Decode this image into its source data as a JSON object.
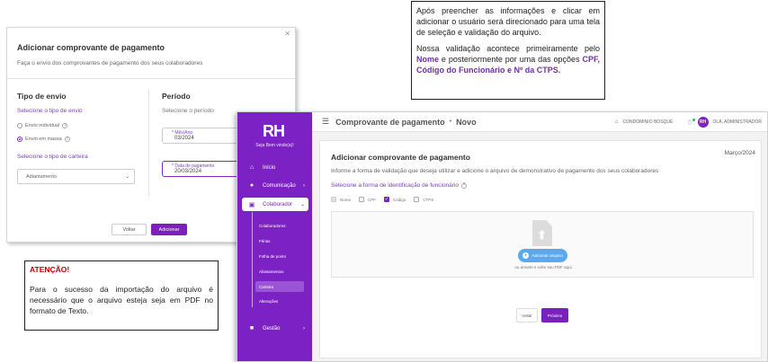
{
  "modal": {
    "close_icon": "close-icon",
    "title": "Adicionar comprovante de pagamento",
    "subtitle": "Faça o envio dos comprovantes de pagamento dos seus colaboradores",
    "left": {
      "heading": "Tipo de envio",
      "send_type_prompt": "Selecione o tipo de envio",
      "options": [
        {
          "label": "Envio individual",
          "selected": false
        },
        {
          "label": "Envio em massa",
          "selected": true
        }
      ],
      "wallet_prompt": "Selecione o tipo de carteira",
      "wallet_value": "Adiantamento"
    },
    "right": {
      "heading": "Período",
      "period_prompt": "Selecione o período",
      "month_label": "* Mês/Ano",
      "month_value": "03/2024",
      "date_label": "* Data de pagamento",
      "date_value": "20/03/2024"
    },
    "buttons": {
      "back": "Voltar",
      "add": "Adicionar"
    }
  },
  "note_top": {
    "p1": "Após preencher as informações e clicar em adicionar o usuário será direcionado para uma tela de seleção e validação do arquivo.",
    "p2_a": "Nossa validação acontece primeiramente pelo ",
    "p2_b": "Nome",
    "p2_c": " e posteriormente por uma das opções ",
    "p2_d": "CPF, Código do Funcionário e Nº da CTPS."
  },
  "note_bottom": {
    "warning": "ATENÇÃO!",
    "text": "Para o sucesso da importação do arquivo é necessário que o arquivo esteja seja em PDF no formato de Texto."
  },
  "app": {
    "logo": "RH",
    "welcome": "Seja Bem vindo(a)!",
    "nav": [
      {
        "label": "Início",
        "icon": "home-icon"
      },
      {
        "label": "Comunicação",
        "icon": "chat-icon"
      },
      {
        "label": "Colaborador",
        "icon": "id-card-icon"
      },
      {
        "label": "Gestão",
        "icon": "briefcase-icon"
      }
    ],
    "submenu": [
      "Colaboradores",
      "Férias",
      "Folha de ponto",
      "Afastamentos",
      "Carteira",
      "Alterações"
    ],
    "topbar": {
      "title": "Comprovante de pagamento",
      "separator": "•",
      "subtitle": "Novo",
      "company": "CONDOMINIO BOSQUE",
      "avatar": "RH",
      "user": "OLÁ, ADMINISTRADOR"
    },
    "card": {
      "title": "Adicionar comprovante de pagamento",
      "date": "Março/2024",
      "subtitle": "Informe a forma de validação que deseja utilizar e adicione o arquivo de demonstrativo de pagamento dos seus colaboradores",
      "select_prompt": "Selecione a forma de identificação de funcionário",
      "checks": [
        {
          "label": "Nome",
          "state": "disabled"
        },
        {
          "label": "CPF",
          "state": "unchecked"
        },
        {
          "label": "Código",
          "state": "checked"
        },
        {
          "label": "CTPS",
          "state": "unchecked"
        }
      ],
      "upload_button": "Adicionar arquivo",
      "drop_hint": "ou arraste e solte seu PDF aqui",
      "back": "Voltar",
      "next": "Próximo"
    }
  }
}
